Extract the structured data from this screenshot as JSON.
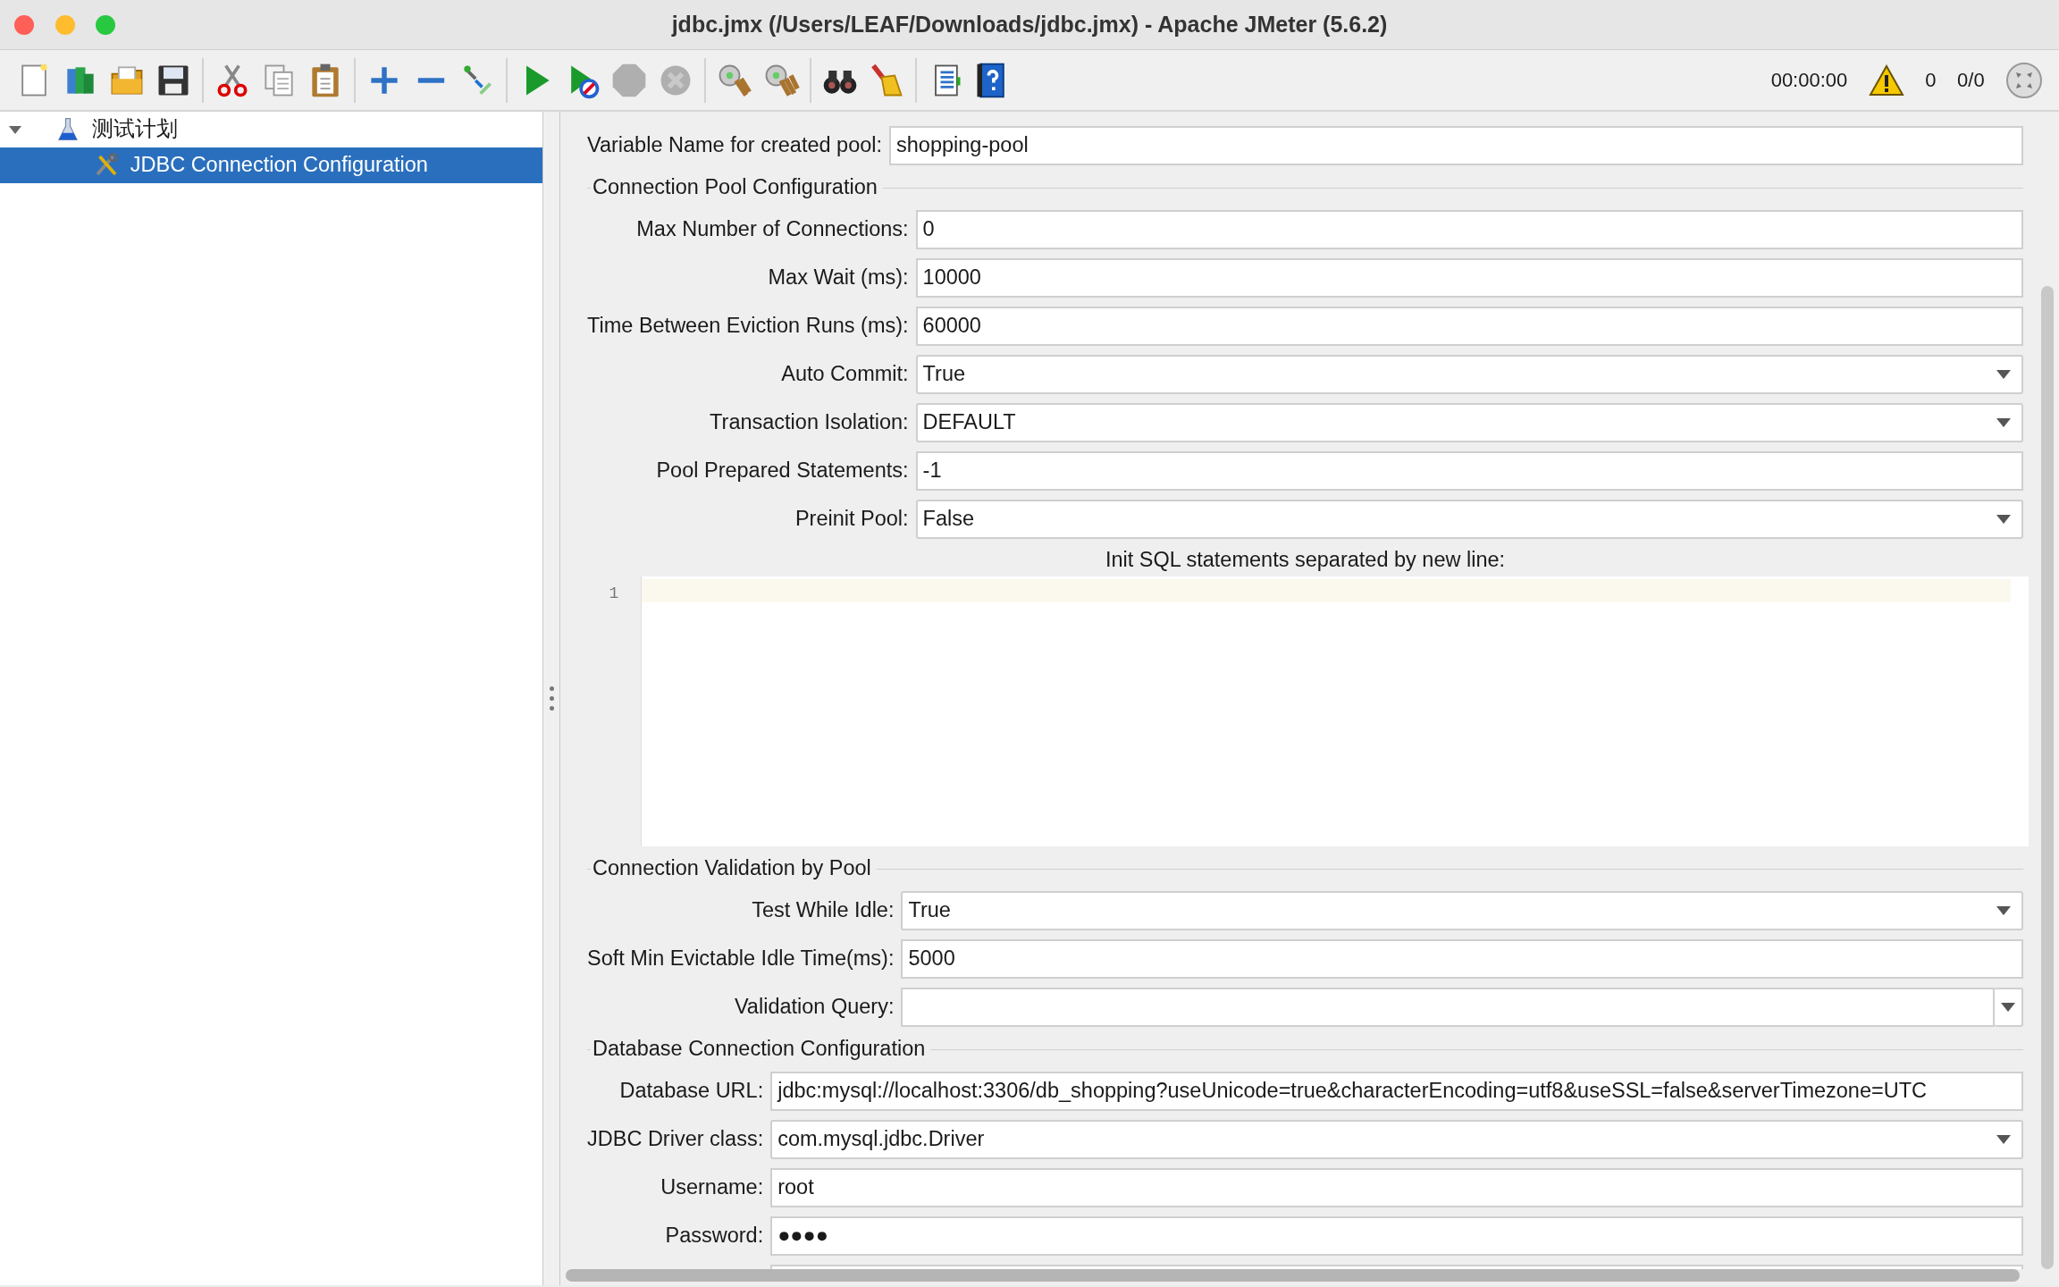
{
  "window": {
    "title": "jdbc.jmx (/Users/LEAF/Downloads/jdbc.jmx) - Apache JMeter (5.6.2)"
  },
  "toolbar": [
    {
      "kind": "new",
      "disabled": false
    },
    {
      "kind": "templates",
      "disabled": false
    },
    {
      "kind": "open",
      "disabled": false
    },
    {
      "kind": "save",
      "disabled": false
    },
    {
      "kind": "separator"
    },
    {
      "kind": "cut",
      "disabled": false
    },
    {
      "kind": "copy",
      "disabled": false
    },
    {
      "kind": "paste",
      "disabled": false
    },
    {
      "kind": "separator"
    },
    {
      "kind": "add",
      "disabled": false
    },
    {
      "kind": "remove",
      "disabled": false
    },
    {
      "kind": "toggle",
      "disabled": false
    },
    {
      "kind": "separator"
    },
    {
      "kind": "start",
      "disabled": false
    },
    {
      "kind": "start-no-pause",
      "disabled": false
    },
    {
      "kind": "stop",
      "disabled": true
    },
    {
      "kind": "shutdown",
      "disabled": true
    },
    {
      "kind": "separator"
    },
    {
      "kind": "clear",
      "disabled": false
    },
    {
      "kind": "clear-all",
      "disabled": false
    },
    {
      "kind": "separator"
    },
    {
      "kind": "search",
      "disabled": false
    },
    {
      "kind": "reset-search",
      "disabled": false
    },
    {
      "kind": "separator"
    },
    {
      "kind": "functions",
      "disabled": false
    },
    {
      "kind": "help",
      "disabled": false
    }
  ],
  "status": {
    "timer": "00:00:00",
    "warnings": "0",
    "threads": "0/0"
  },
  "tree": [
    {
      "label": "测试计划",
      "kind": "test-plan",
      "expanded": true,
      "selected": false,
      "children": [
        {
          "label": "JDBC Connection Configuration",
          "kind": "config",
          "selected": true
        }
      ]
    }
  ],
  "pool_variable": {
    "label": "Variable Name for created pool:",
    "value": "shopping-pool"
  },
  "sections": [
    {
      "title": "Connection Pool Configuration",
      "fields": [
        {
          "label": "Max Number of Connections:",
          "value": "0",
          "kind": "text"
        },
        {
          "label": "Max Wait (ms):",
          "value": "10000",
          "kind": "text"
        },
        {
          "label": "Time Between Eviction Runs (ms):",
          "value": "60000",
          "kind": "text"
        },
        {
          "label": "Auto Commit:",
          "value": "True",
          "kind": "select"
        },
        {
          "label": "Transaction Isolation:",
          "value": "DEFAULT",
          "kind": "select"
        },
        {
          "label": "Pool Prepared Statements:",
          "value": "-1",
          "kind": "text"
        },
        {
          "label": "Preinit Pool:",
          "value": "False",
          "kind": "select"
        }
      ],
      "editor": {
        "label": "Init SQL statements separated by new line:",
        "line_numbers": [
          "1"
        ]
      }
    },
    {
      "title": "Connection Validation by Pool",
      "fields": [
        {
          "label": "Test While Idle:",
          "value": "True",
          "kind": "select"
        },
        {
          "label": "Soft Min Evictable Idle Time(ms):",
          "value": "5000",
          "kind": "text"
        },
        {
          "label": "Validation Query:",
          "kind": "combo"
        }
      ]
    },
    {
      "title": "Database Connection Configuration",
      "fields": [
        {
          "label": "Database URL:",
          "value": "jdbc:mysql://localhost:3306/db_shopping?useUnicode=true&characterEncoding=utf8&useSSL=false&serverTimezone=UTC",
          "kind": "text"
        },
        {
          "label": "JDBC Driver class:",
          "value": "com.mysql.jdbc.Driver",
          "kind": "select"
        },
        {
          "label": "Username:",
          "value": "root",
          "kind": "text"
        },
        {
          "label": "Password:",
          "value": "●●●●",
          "kind": "text"
        }
      ]
    }
  ]
}
